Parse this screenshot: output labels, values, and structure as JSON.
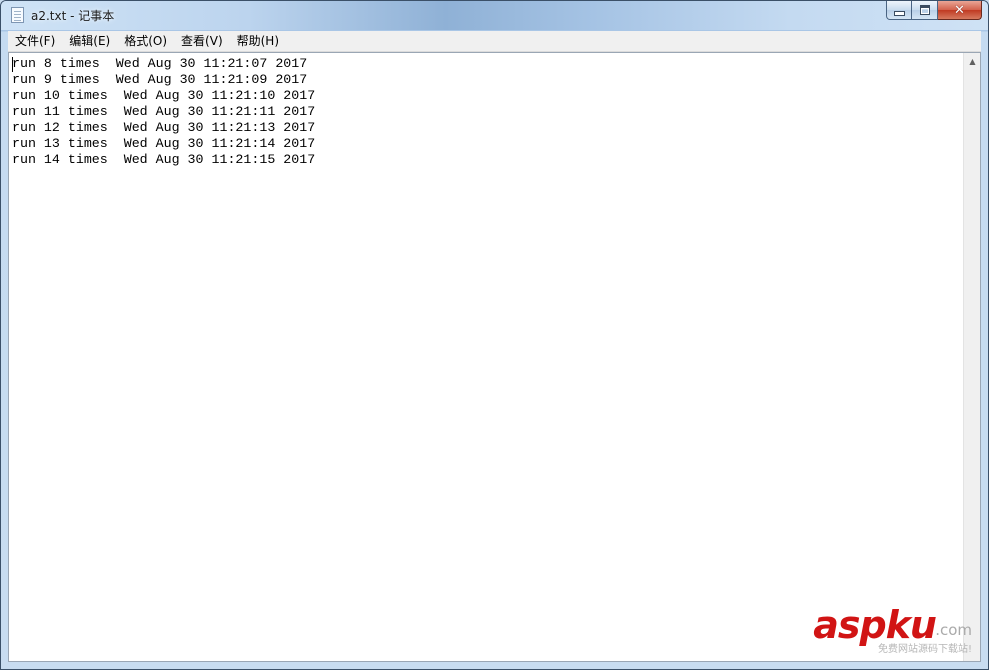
{
  "window": {
    "title": "a2.txt - 记事本",
    "icon": "notepad-icon"
  },
  "menu": [
    {
      "label": "文件(F)"
    },
    {
      "label": "编辑(E)"
    },
    {
      "label": "格式(O)"
    },
    {
      "label": "查看(V)"
    },
    {
      "label": "帮助(H)"
    }
  ],
  "document": {
    "lines": [
      "run 8 times  Wed Aug 30 11:21:07 2017",
      "run 9 times  Wed Aug 30 11:21:09 2017",
      "run 10 times  Wed Aug 30 11:21:10 2017",
      "run 11 times  Wed Aug 30 11:21:11 2017",
      "run 12 times  Wed Aug 30 11:21:13 2017",
      "run 13 times  Wed Aug 30 11:21:14 2017",
      "run 14 times  Wed Aug 30 11:21:15 2017"
    ]
  },
  "watermark": {
    "logo": "aspku",
    "suffix": ".com",
    "tagline": "免费网站源码下载站!"
  },
  "colors": {
    "close_button": "#c03a22",
    "watermark_red": "#d11414"
  }
}
